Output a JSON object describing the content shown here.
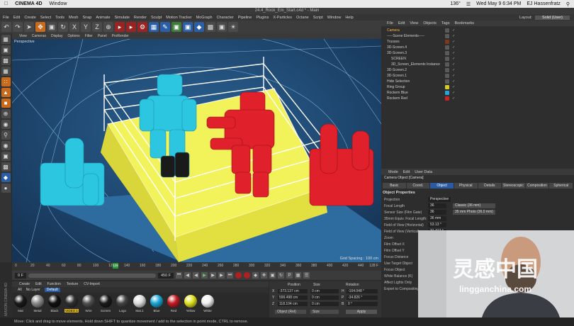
{
  "mac_menu": {
    "app_name": "CINEMA 4D",
    "window_menu": "Window",
    "battery": "136°",
    "datetime": "Wed May 9  6:34 PM",
    "user": "EJ Hassenfratz"
  },
  "window_title": "24.4_Rock_Em_Start.c4d * - Main",
  "main_menu": [
    "File",
    "Edit",
    "Create",
    "Select",
    "Tools",
    "Mesh",
    "Snap",
    "Animate",
    "Simulate",
    "Render",
    "Sculpt",
    "Motion Tracker",
    "MoGraph",
    "Character",
    "Pipeline",
    "Plugins",
    "X-Particles",
    "Octane",
    "Script",
    "Window",
    "Help"
  ],
  "layout": {
    "label": "Layout:",
    "value": "Solid (User)"
  },
  "viewport_menu": [
    "View",
    "Cameras",
    "Display",
    "Options",
    "Filter",
    "Panel",
    "ProRender"
  ],
  "viewport": {
    "label": "Perspective",
    "grid_spacing": "Grid Spacing : 100 cm"
  },
  "timeline": {
    "ticks": [
      "0",
      "20",
      "40",
      "60",
      "80",
      "100",
      "120",
      "140",
      "160",
      "180",
      "200",
      "220",
      "240",
      "260",
      "280",
      "300",
      "320",
      "340",
      "360",
      "380",
      "400",
      "420",
      "440"
    ],
    "current_frame": "128",
    "end_label": "128 F",
    "start_field": "0 F",
    "end_field": "450 F"
  },
  "material_menu": [
    "Create",
    "Edit",
    "Function",
    "Texture",
    "CV-Import"
  ],
  "material_tabs": [
    "All",
    "No Layer",
    "Default"
  ],
  "materials": [
    {
      "name": "Mat",
      "color": "#1a1a1a"
    },
    {
      "name": "Metal",
      "color": "#8a8a8a"
    },
    {
      "name": "Black",
      "color": "#111111"
    },
    {
      "name": "VIDEO 1",
      "color": "#303030"
    },
    {
      "name": "Wire",
      "color": "#505050"
    },
    {
      "name": "Screen",
      "color": "#1b1b1b"
    },
    {
      "name": "Logo",
      "color": "#444444"
    },
    {
      "name": "Mat.1",
      "color": "#dcdcdc"
    },
    {
      "name": "Blue",
      "color": "#1aa6d6"
    },
    {
      "name": "Red",
      "color": "#c41c24"
    },
    {
      "name": "Yellow",
      "color": "#e0e020"
    },
    {
      "name": "White",
      "color": "#f0f0f0"
    }
  ],
  "coordinates": {
    "headers": [
      "Position",
      "Size",
      "Rotation"
    ],
    "rows": [
      {
        "axis": "X",
        "pos": "-373.137 cm",
        "size": "0 cm",
        "rot_axis": "H",
        "rot": "-104.048 °"
      },
      {
        "axis": "Y",
        "pos": "599.498 cm",
        "size": "0 cm",
        "rot_axis": "P",
        "rot": "-34.826 °"
      },
      {
        "axis": "Z",
        "pos": "118.104 cm",
        "size": "0 cm",
        "rot_axis": "B",
        "rot": "0 °"
      }
    ],
    "mode": "Object (Rel)",
    "size_mode": "Size",
    "apply": "Apply"
  },
  "status_text": "Move: Click and drag to move elements. Hold down SHIFT to quantize movement / add to the selection in point mode, CTRL to remove.",
  "maxon": "MAXON CINEMA 4D",
  "objects_menu": [
    "File",
    "Edit",
    "View",
    "Objects",
    "Tags",
    "Bookmarks"
  ],
  "objects": [
    {
      "name": "Camera",
      "indent": 0,
      "tag": "#5a5a5a",
      "selected": true
    },
    {
      "name": "-----Scene Elements-----",
      "indent": 0,
      "tag": "#5a5a5a"
    },
    {
      "name": "Trusses",
      "indent": 0,
      "tag": "#7a3a1a"
    },
    {
      "name": "3D-Screen.4",
      "indent": 0,
      "tag": "#5a5a5a"
    },
    {
      "name": "3D-Screen.3",
      "indent": 0,
      "tag": "#5a5a5a"
    },
    {
      "name": "SCREEN",
      "indent": 1,
      "tag": "#5a5a5a"
    },
    {
      "name": "3D_Screen_Elements Instance",
      "indent": 1,
      "tag": "#5a5a5a"
    },
    {
      "name": "3D-Screen.2",
      "indent": 0,
      "tag": "#5a5a5a"
    },
    {
      "name": "3D-Screen.1",
      "indent": 0,
      "tag": "#5a5a5a"
    },
    {
      "name": "Hide Selection",
      "indent": 0,
      "tag": "#5a5a5a"
    },
    {
      "name": "Ring Group",
      "indent": 0,
      "tag": "#d6c92a"
    },
    {
      "name": "Rockem Blue",
      "indent": 0,
      "tag": "#2aa2d6"
    },
    {
      "name": "Rockem Red",
      "indent": 0,
      "tag": "#c42424"
    }
  ],
  "attr_menu": [
    "Mode",
    "Edit",
    "User Data"
  ],
  "attr_header": "Camera Object [Camera]",
  "attr_tabs": [
    "Basic",
    "Coord.",
    "Object",
    "Physical",
    "Details",
    "Stereoscopic",
    "Composition",
    "Spherical"
  ],
  "attr_active_tab": "Object",
  "attr_section": "Object Properties",
  "attr_rows": [
    {
      "label": "Projection",
      "value": "Perspective"
    },
    {
      "label": "Focal Length",
      "value": "36",
      "option": "Classic (36 mm)"
    },
    {
      "label": "Sensor Size (Film Gate)",
      "value": "36",
      "option": "35 mm Photo (36.0 mm)"
    },
    {
      "label": "35mm Equiv. Focal Length:",
      "value": "36 mm"
    },
    {
      "label": "Field of View (Horizontal)",
      "value": "53.13 °"
    },
    {
      "label": "Field of View (Vertical)",
      "value": "31.417 °"
    },
    {
      "label": "Zoom",
      "value": ""
    },
    {
      "label": "Film Offset X",
      "value": "0 %"
    },
    {
      "label": "Film Offset Y",
      "value": "0 %"
    },
    {
      "label": "Focus Distance",
      "value": "2000 cm"
    },
    {
      "label": "Use Target Object",
      "value": ""
    },
    {
      "label": "Focus Object",
      "value": ""
    },
    {
      "label": "White Balance (K)",
      "value": "6500"
    },
    {
      "label": "Affect Lights Only",
      "value": ""
    },
    {
      "label": "Export to Compositing",
      "value": ""
    }
  ],
  "watermark": {
    "cn": "灵感中国",
    "url": "lingganchina.com"
  }
}
